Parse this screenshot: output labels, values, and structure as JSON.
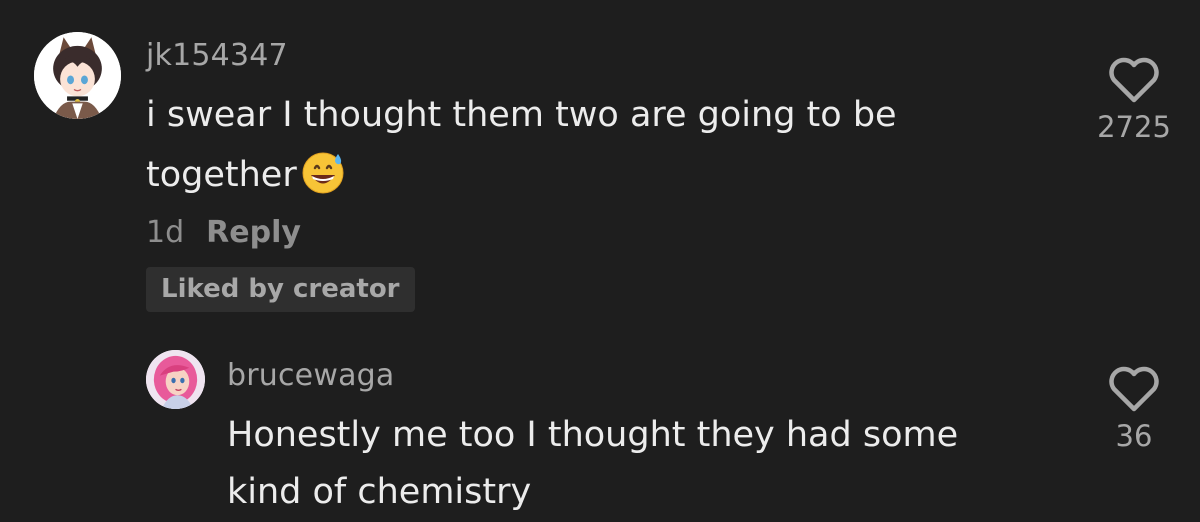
{
  "comment": {
    "username": "jk154347",
    "text_line1": "i swear I thought them two are going to be",
    "text_line2": "together",
    "emoji": "grinning-face-with-sweat",
    "time": "1d",
    "reply_label": "Reply",
    "badge": "Liked by creator",
    "like_count": "2725"
  },
  "reply": {
    "username": "brucewaga",
    "text_line1": "Honestly me too I thought they had some",
    "text_line2": "kind of chemistry",
    "like_count": "36"
  },
  "icons": {
    "like": "heart-outline-icon",
    "emoji": "grinning-face-with-sweat"
  },
  "colors": {
    "background": "#1e1e1e",
    "username": "#a7a7a7",
    "text": "#ececec",
    "meta": "#8e8e8e",
    "badge_bg": "#2f2f2f"
  }
}
